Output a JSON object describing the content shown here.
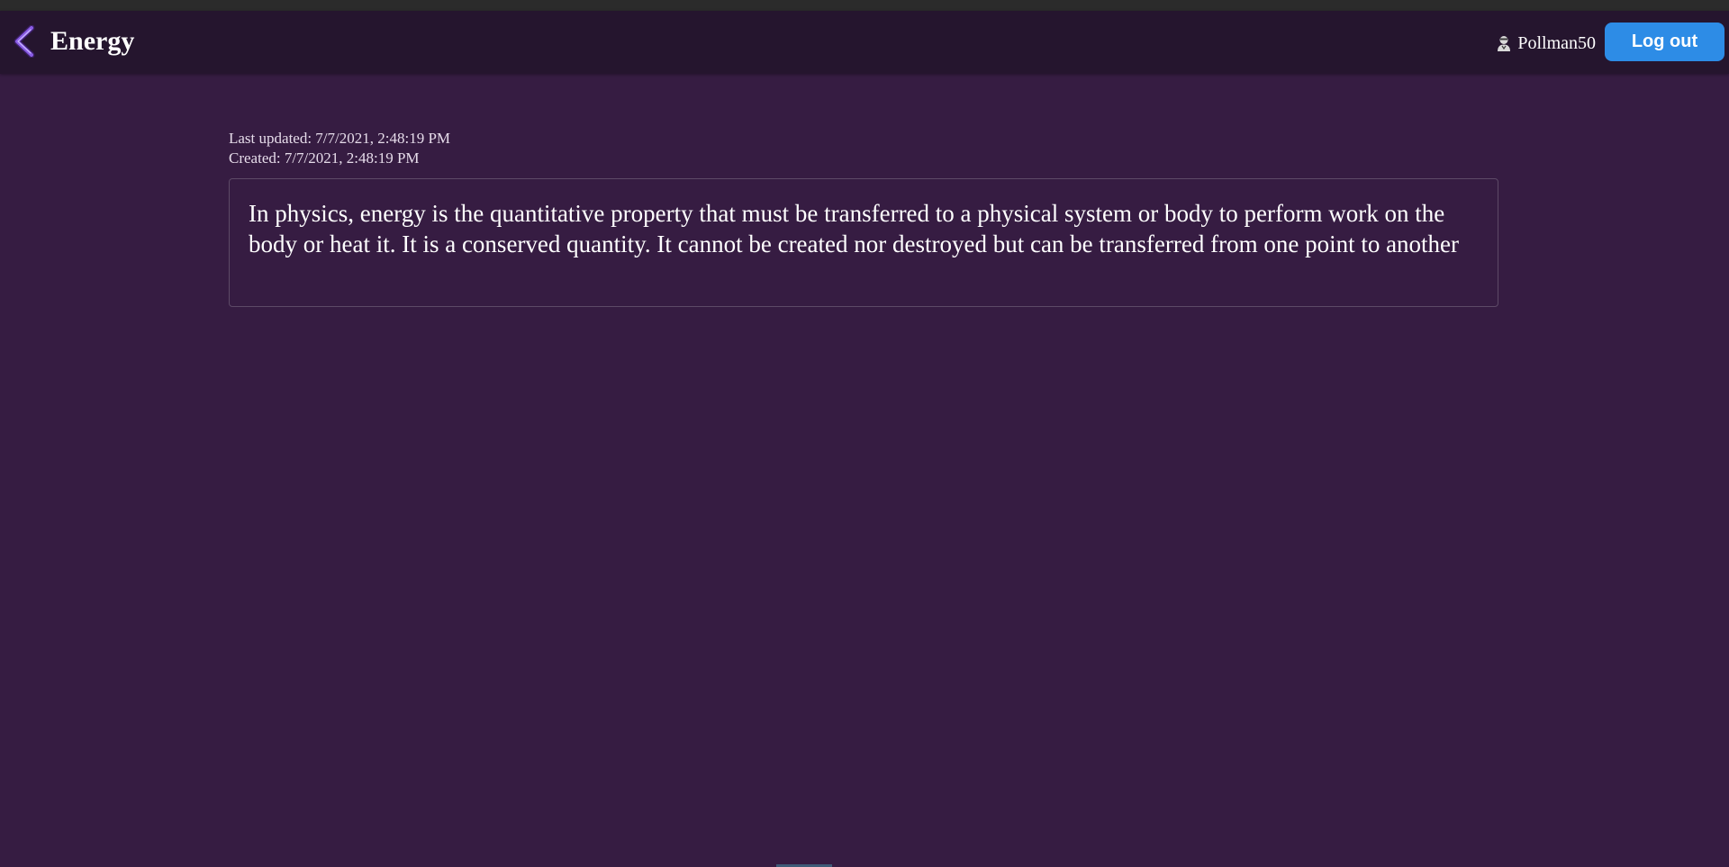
{
  "header": {
    "back_icon": "chevron-left-icon",
    "title": "Energy",
    "user_icon": "user-icon",
    "username": "Pollman50",
    "logout_label": "Log out"
  },
  "meta": {
    "last_updated": "Last updated: 7/7/2021, 2:48:19 PM",
    "created": "Created: 7/7/2021, 2:48:19 PM"
  },
  "content": {
    "text": "In physics, energy is the quantitative property that must be transferred to a physical system or body to perform work on the body or heat it. It is a conserved quantity. It cannot be created nor destroyed but can be transferred from one point to another"
  },
  "colors": {
    "page_background": "#361c42",
    "header_background": "#25152e",
    "logout_button": "#2d8ce6",
    "back_icon_accent": "#8a5ce6"
  }
}
